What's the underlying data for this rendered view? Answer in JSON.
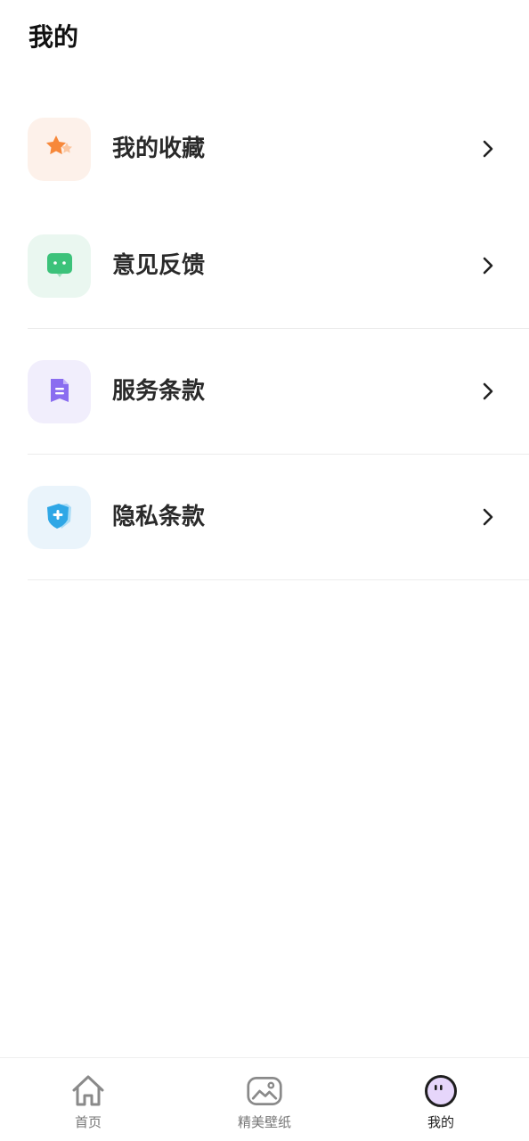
{
  "header": {
    "title": "我的"
  },
  "menu": {
    "items": [
      {
        "label": "我的收藏",
        "icon": "star-icon",
        "tile_color": "#fdf1ea",
        "accent": "#f7883a"
      },
      {
        "label": "意见反馈",
        "icon": "chat-bubble-icon",
        "tile_color": "#eaf7f0",
        "accent": "#3cc27a"
      },
      {
        "label": "服务条款",
        "icon": "document-icon",
        "tile_color": "#f1eefc",
        "accent": "#8a6df0"
      },
      {
        "label": "隐私条款",
        "icon": "shield-icon",
        "tile_color": "#eaf4fb",
        "accent": "#2fa7e6"
      }
    ]
  },
  "tabbar": {
    "tabs": [
      {
        "label": "首页",
        "icon": "home-icon",
        "active": false
      },
      {
        "label": "精美壁纸",
        "icon": "image-icon",
        "active": false
      },
      {
        "label": "我的",
        "icon": "avatar-face-icon",
        "active": true
      }
    ]
  }
}
